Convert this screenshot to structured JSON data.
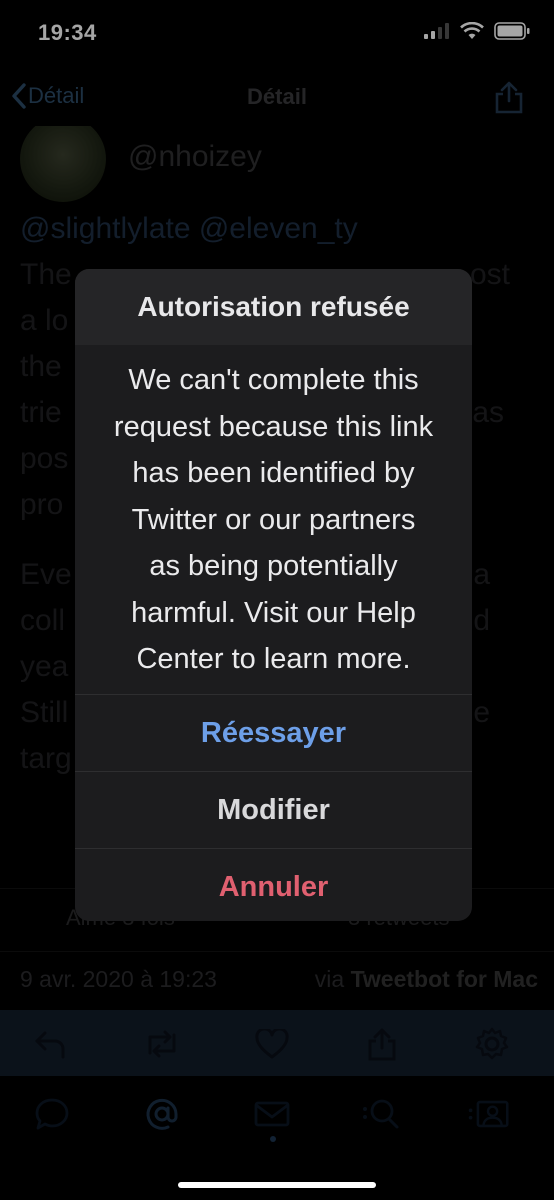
{
  "status_bar": {
    "time": "19:34"
  },
  "nav": {
    "back_label": "Détail",
    "title": "Détail"
  },
  "tweet": {
    "handle": "@nhoizey",
    "mentions": "@slightlylate @eleven_ty",
    "line1": "The",
    "line1_end": "ost",
    "line2": "a lo",
    "line3": "the",
    "line4": "trie",
    "line4_end": "as",
    "line5": "pos",
    "line6": "pro",
    "line7": "Eve",
    "line7_end": "a",
    "line8": "coll",
    "line8_end": "d",
    "line9": "yea",
    "line10": "Still",
    "line10_end": "e",
    "line11": "targ",
    "likes": "Aimé 3 fois",
    "retweets": "3 retweets",
    "date": "9 avr. 2020 à 19:23",
    "via_prefix": "via",
    "via_app": "Tweetbot for Mac"
  },
  "alert": {
    "title": "Autorisation refusée",
    "message": "We can't complete this\nrequest because this link\nhas been identified by\nTwitter or our partners\nas being potentially\nharmful. Visit our Help\nCenter to learn more.",
    "retry_label": "Réessayer",
    "modify_label": "Modifier",
    "cancel_label": "Annuler"
  },
  "colors": {
    "retry": "#6d9fe8",
    "cancel": "#e06070",
    "action_bar": "#121c29"
  },
  "icons": [
    "reply-icon",
    "retweet-icon",
    "heart-icon",
    "share-icon",
    "gear-icon",
    "speech-bubble-icon",
    "at-icon",
    "mail-icon",
    "search-icon",
    "profile-icon"
  ]
}
